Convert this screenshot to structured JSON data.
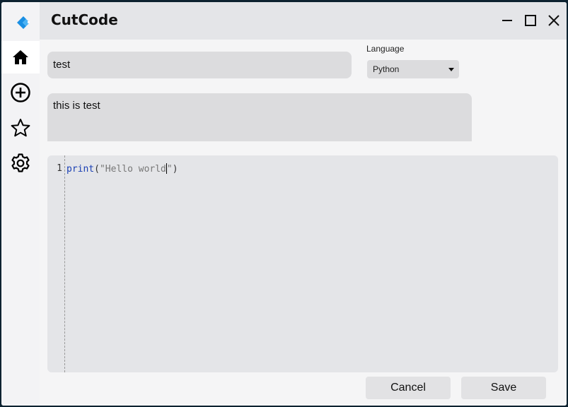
{
  "app": {
    "title": "CutCode"
  },
  "sidebar": {
    "items": [
      {
        "name": "home",
        "icon": "home-icon"
      },
      {
        "name": "add",
        "icon": "plus-circle-icon"
      },
      {
        "name": "favorites",
        "icon": "star-icon"
      },
      {
        "name": "settings",
        "icon": "gear-icon"
      }
    ]
  },
  "form": {
    "title_value": "test",
    "language_label": "Language",
    "language_selected": "Python",
    "description_value": "this is test"
  },
  "editor": {
    "line_number": "1",
    "code_keyword": "print",
    "code_open": "(",
    "code_string_a": "\"Hello world",
    "code_string_b": "\"",
    "code_close": ")"
  },
  "actions": {
    "cancel_label": "Cancel",
    "save_label": "Save"
  },
  "colors": {
    "accent": "#1a8fe3",
    "keyword": "#1a3fb3"
  }
}
